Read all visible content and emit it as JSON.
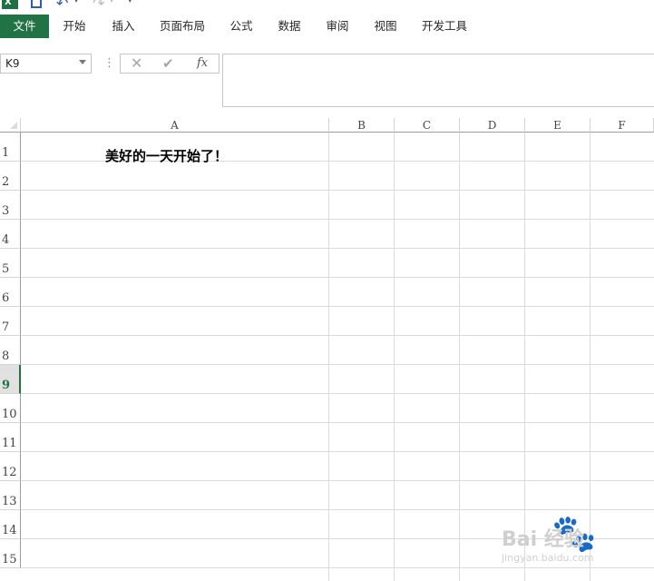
{
  "quick_access": {
    "app_icon_text": "X",
    "undo_dropdown": "▾",
    "redo_dropdown": "▾",
    "customize": "▾"
  },
  "ribbon": {
    "tabs": [
      "文件",
      "开始",
      "插入",
      "页面布局",
      "公式",
      "数据",
      "审阅",
      "视图",
      "开发工具"
    ]
  },
  "formula_bar": {
    "name_box": "K9",
    "cancel_symbol": "✕",
    "enter_symbol": "✔",
    "function_symbol": "fx",
    "content": ""
  },
  "sheet": {
    "columns": [
      "A",
      "B",
      "C",
      "D",
      "E",
      "F"
    ],
    "rows": [
      "1",
      "2",
      "3",
      "4",
      "5",
      "6",
      "7",
      "8",
      "9",
      "10",
      "11",
      "12",
      "13",
      "14",
      "15"
    ],
    "selected_row": "9",
    "cells": {
      "A1": "美好的一天开始了！"
    }
  },
  "watermark": {
    "brand": "Bai 经验",
    "url": "jingyan.baidu.com"
  },
  "colors": {
    "excel_green": "#217346",
    "grid_line": "#dadada"
  }
}
